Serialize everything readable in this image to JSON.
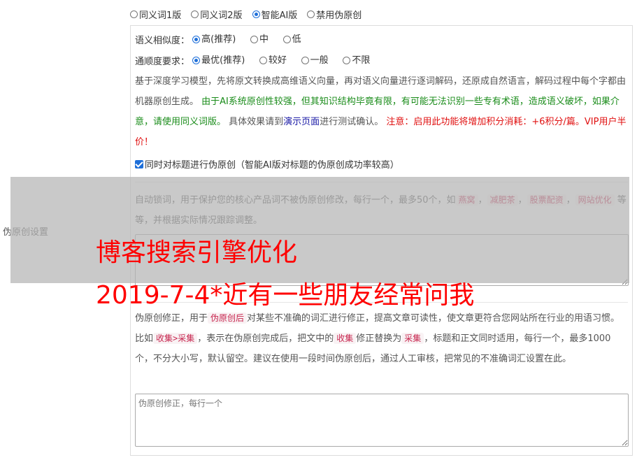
{
  "row_label": "伪原创设置",
  "versions": [
    {
      "label": "同义词1版",
      "checked": false
    },
    {
      "label": "同义词2版",
      "checked": false
    },
    {
      "label": "智能AI版",
      "checked": true
    },
    {
      "label": "禁用伪原创",
      "checked": false
    }
  ],
  "similarity": {
    "label": "语义相似度：",
    "options": [
      {
        "label": "高(推荐)",
        "checked": true
      },
      {
        "label": "中",
        "checked": false
      },
      {
        "label": "低",
        "checked": false
      }
    ]
  },
  "fluency": {
    "label": "通顺度要求：",
    "options": [
      {
        "label": "最优(推荐)",
        "checked": true
      },
      {
        "label": "较好",
        "checked": false
      },
      {
        "label": "一般",
        "checked": false
      },
      {
        "label": "不限",
        "checked": false
      }
    ]
  },
  "description": {
    "part1": "基于深度学习模型，先将原文转换成高维语义向量，再对语义向量进行逐词解码，还原成自然语言，解码过程中每个字都由机器原创生成。",
    "warning_green": "由于AI系统原创性较强，但其知识结构毕竟有限，有可能无法识别一些专有术语，造成语义破坏，如果介意，请使用同义词版。",
    "part2": "具体效果请到",
    "demo_link": "演示页面",
    "part3": "进行测试确认。",
    "warning_red": "注意：启用此功能将增加积分消耗：+6积分/篇。VIP用户半价！"
  },
  "title_checkbox": {
    "label": "同时对标题进行伪原创（智能AI版对标题的伪原创成功率较高）",
    "checked": true
  },
  "lock_words": {
    "text1": "自动锁词，用于保护您的核心产品词不被伪原创修改，每行一个，最多50个，如",
    "examples": [
      "燕窝",
      "减肥茶",
      "股票配资",
      "网站优化"
    ],
    "sep": "，",
    "text2": "等等，并根据实际情况跟踪调整。"
  },
  "correction": {
    "text1": "伪原创修正，用于",
    "tag1": "伪原创后",
    "text2": "对某些不准确的词汇进行修正，提高文章可读性，使文章更符合您网站所在行业的用语习惯。比如",
    "tag2": "收集>采集",
    "text3": "，表示在伪原创完成后，把文中的",
    "tag3": "收集",
    "text4": "修正替换为",
    "tag4": "采集",
    "text5": "，标题和正文同时适用，每行一个，最多1000个，不分大小写，默认留空。建议在使用一段时间伪原创后，通过人工审核，把常见的不准确词汇设置在此。",
    "placeholder": "伪原创修正，每行一个"
  },
  "watermark": {
    "line1": "博客搜索引擎优化",
    "line2": "2019-7-4*近有一些朋友经常问我"
  }
}
